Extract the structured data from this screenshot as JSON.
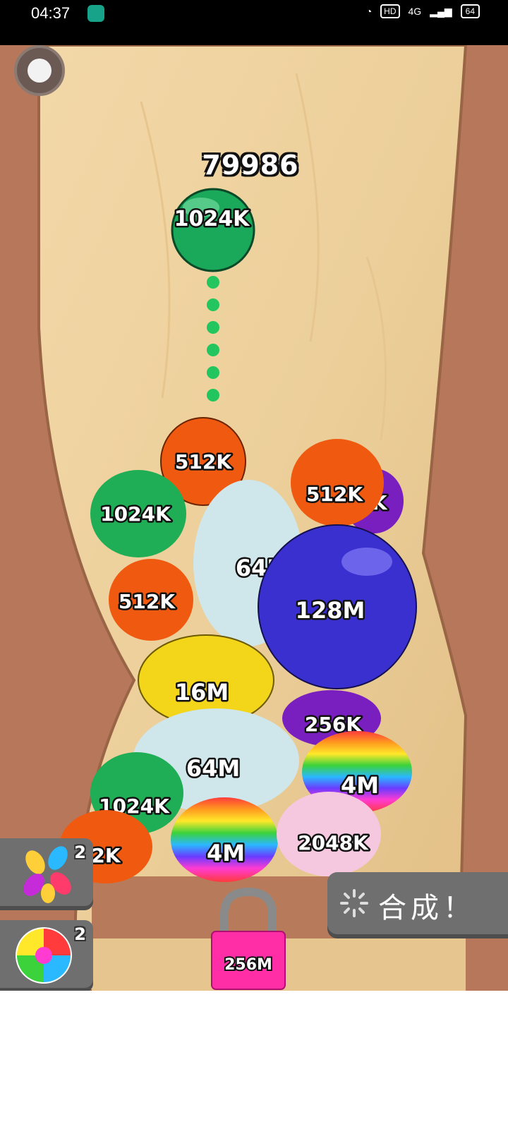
{
  "status_bar": {
    "time": "04:37",
    "hd": "HD",
    "network": "4G",
    "battery": "64"
  },
  "hud": {
    "score": "79986"
  },
  "drop_ball": {
    "label": "1024K",
    "color": "#1aa85a"
  },
  "balls": [
    {
      "label": "512K",
      "color": "#f05a10"
    },
    {
      "label": "1024K",
      "color": "#1fae56"
    },
    {
      "label": "512K",
      "color": "#f05a10"
    },
    {
      "label": "64M",
      "color": "#cfe6ea"
    },
    {
      "label": "512K",
      "color": "#f05a10"
    },
    {
      "label": "128M",
      "color": "#3a2fcf"
    },
    {
      "label": "16M",
      "color": "#f3d51a"
    },
    {
      "label": "256K",
      "color": "#7a1fbf"
    },
    {
      "label": "64M",
      "color": "#cfe6ea"
    },
    {
      "label": "4M",
      "color": "rainbow"
    },
    {
      "label": "1024K",
      "color": "#1fae56"
    },
    {
      "label": "2K",
      "color": "#f05a10"
    },
    {
      "label": "4M",
      "color": "rainbow"
    },
    {
      "label": "2048K",
      "color": "#f5c8e0"
    },
    {
      "label": "6K",
      "color": "#7a1fbf"
    }
  ],
  "lock": {
    "label": "256M",
    "color": "#ff2ea6"
  },
  "buttons": {
    "candy_powerup_count": "2",
    "rainbow_powerup_count": "2",
    "merge_label": "合成！"
  }
}
